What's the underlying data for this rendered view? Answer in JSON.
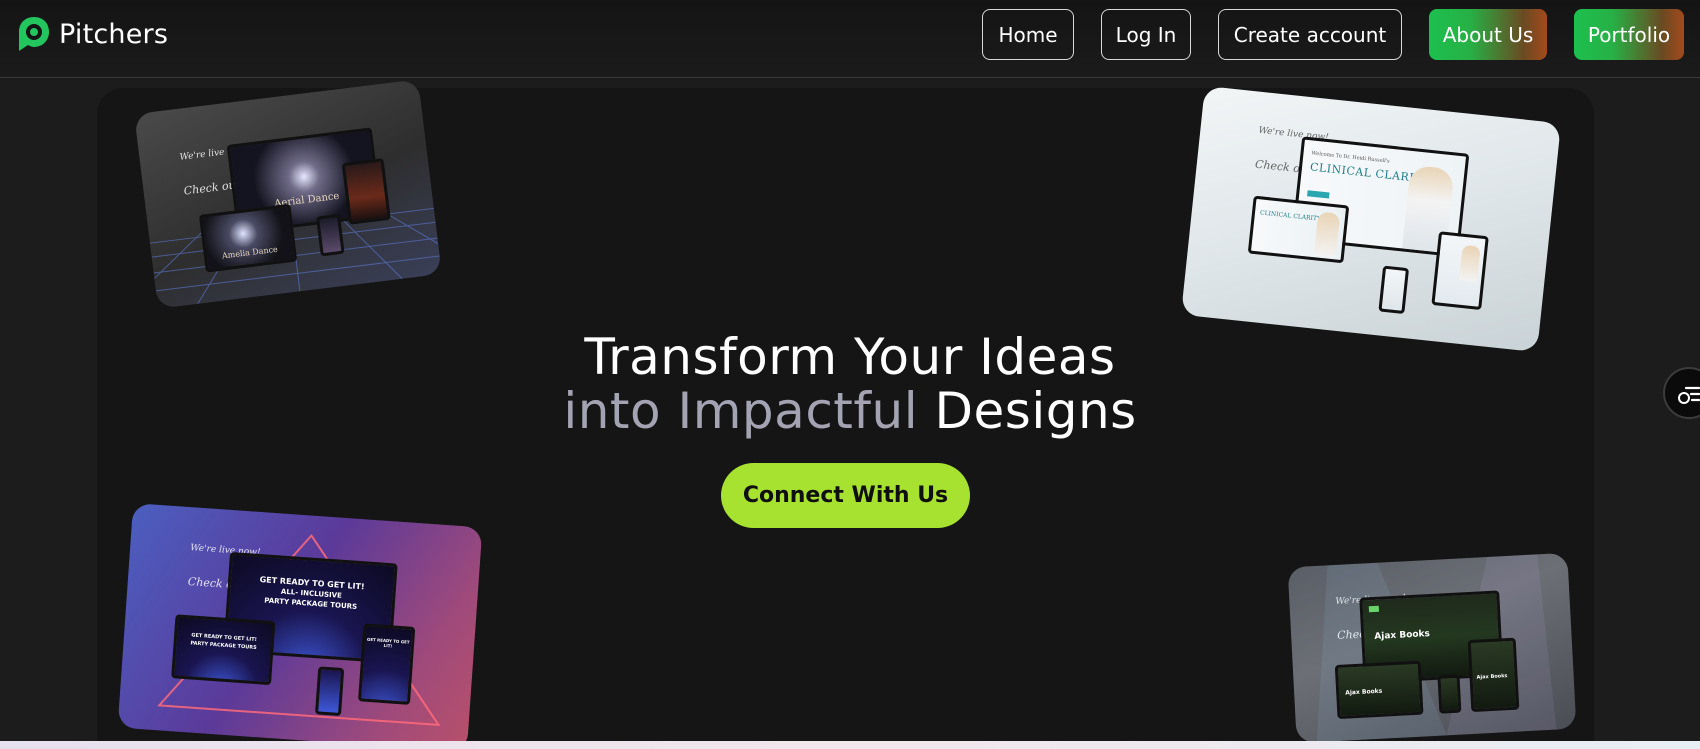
{
  "brand": {
    "name": "Pitchers",
    "logo_icon": "pitchers-logo-icon",
    "logo_color": "#22c55e"
  },
  "nav": {
    "home": "Home",
    "login": "Log In",
    "create_account": "Create account",
    "about": "About Us",
    "portfolio": "Portfolio"
  },
  "hero": {
    "title_line1": "Transform Your Ideas",
    "title_line2_muted": "into Impactful",
    "title_line2_strong": "Designs",
    "cta": "Connect With Us"
  },
  "mockups": {
    "card1": {
      "caption_top": "We're live now!",
      "caption_script": "Check out our new website",
      "screen_title": "Aerial Dance",
      "screen_sub": "Amelia Dance"
    },
    "card2": {
      "caption_top": "We're live now!",
      "caption_script": "Check out our new website",
      "screen_title": "CLINICAL CLARITY",
      "screen_welcome": "Welcome To Dr. Heidi Russell's"
    },
    "card3": {
      "caption_top": "We're live now!",
      "caption_script": "Check out our new website",
      "screen_title": "GET READY TO GET LIT!",
      "screen_line2": "ALL- INCLUSIVE",
      "screen_line3": "PARTY PACKAGE TOURS"
    },
    "card4": {
      "caption_top": "We're live now!",
      "caption_script": "Check out our new website",
      "screen_title": "Ajax Books"
    }
  },
  "colors": {
    "accent_green": "#a6e22f",
    "nav_gradient_start": "#1cc04f",
    "nav_gradient_end": "#a34a1c",
    "muted_text": "#a3a3b3"
  },
  "side_widget": {
    "icon": "accessibility-menu-icon"
  }
}
